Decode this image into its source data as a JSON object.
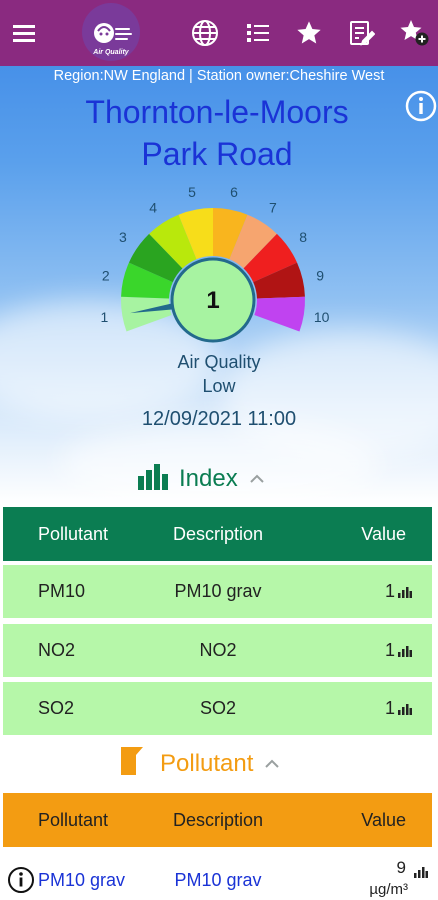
{
  "toolbar": {
    "logo_text": "Air Quality",
    "icons": [
      "menu-icon",
      "globe-icon",
      "list-icon",
      "star-icon",
      "edit-note-icon",
      "add-favourite-icon"
    ]
  },
  "region_line": "Region:NW England | Station owner:Cheshire West",
  "station": {
    "line1": "Thornton-le-Moors",
    "line2": "Park Road"
  },
  "gauge": {
    "value": "1",
    "level": 1,
    "scale": [
      "1",
      "2",
      "3",
      "4",
      "5",
      "6",
      "7",
      "8",
      "9",
      "10"
    ],
    "colors": [
      "#a7f3a1",
      "#3ad62b",
      "#2aa420",
      "#b9e80c",
      "#f7dd1a",
      "#f9b51e",
      "#f6a56f",
      "#ef1f1f",
      "#b01414",
      "#c043f0"
    ],
    "label": "Air Quality",
    "band": "Low"
  },
  "datetime": "12/09/2021 11:00",
  "index_section": {
    "title": "Index",
    "headers": {
      "pollutant": "Pollutant",
      "description": "Description",
      "value": "Value"
    },
    "rows": [
      {
        "pollutant": "PM10",
        "description": "PM10 grav",
        "value": "1"
      },
      {
        "pollutant": "NO2",
        "description": "NO2",
        "value": "1"
      },
      {
        "pollutant": "SO2",
        "description": "SO2",
        "value": "1"
      }
    ]
  },
  "pollutant_section": {
    "title": "Pollutant",
    "headers": {
      "pollutant": "Pollutant",
      "description": "Description",
      "value": "Value"
    },
    "rows": [
      {
        "pollutant": "PM10 grav",
        "description": "PM10 grav",
        "value": "9",
        "unit": "µg/m³"
      }
    ]
  },
  "colors": {
    "topbar": "#8a2a80",
    "station_title": "#1a33d6",
    "index_green": "#0b7d52",
    "pollutant_orange": "#f39c12",
    "row_green": "#b6f7a9"
  }
}
